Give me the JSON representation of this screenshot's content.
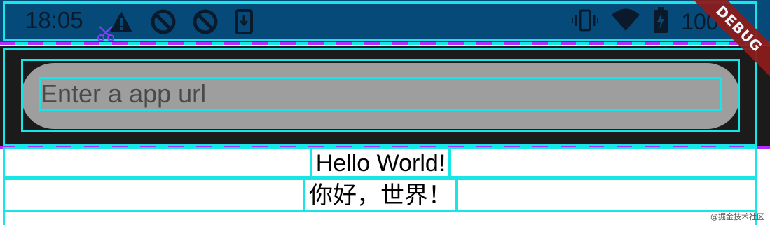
{
  "status_bar": {
    "time": "18:05",
    "battery_text": "100%",
    "left_icons": [
      "alert-icon",
      "no-entry-icon",
      "no-entry-icon",
      "download-icon"
    ],
    "right_icons": [
      "vibrate-icon",
      "wifi-icon",
      "battery-icon"
    ],
    "background_color": "#064a7a"
  },
  "debug_banner": {
    "label": "DEBUG"
  },
  "app_bar": {
    "search_placeholder": "Enter a app url",
    "background_color": "#1b1b1b"
  },
  "content": {
    "line1": "Hello World!",
    "line2": "你好，世界！"
  },
  "watermark": "@掘金技术社区",
  "colors": {
    "debug_outline": "#18e6e6",
    "debug_dash": "#b02cff"
  }
}
